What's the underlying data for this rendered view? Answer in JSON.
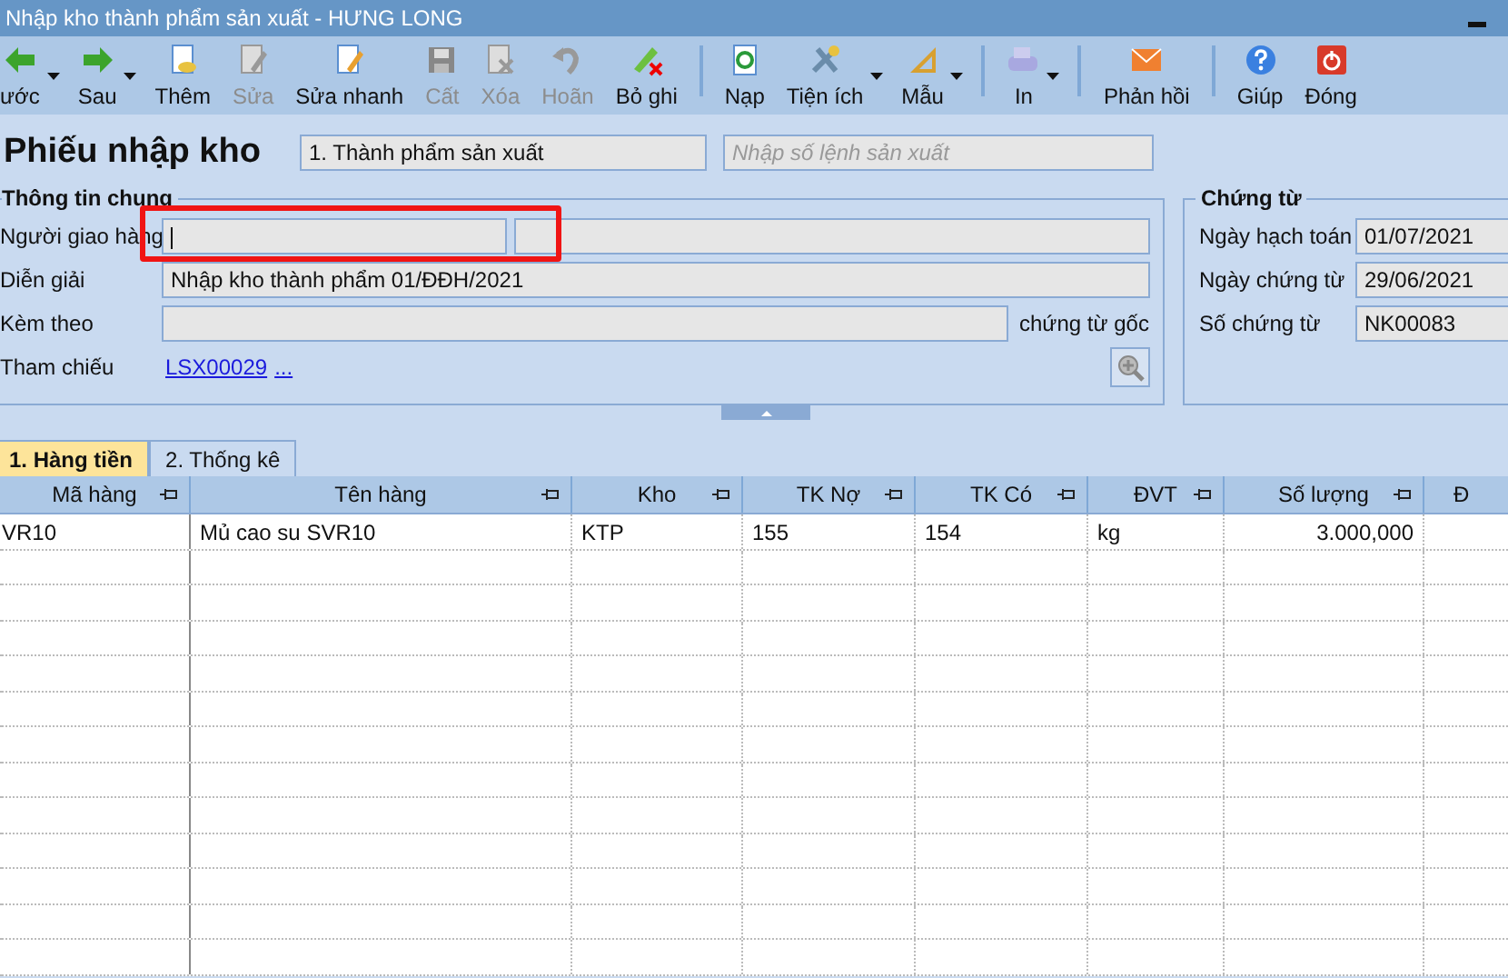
{
  "window": {
    "title": "Nhập kho thành phẩm sản xuất - HƯNG LONG"
  },
  "toolbar": [
    {
      "label": "ước",
      "disabled": false,
      "dropdown": true
    },
    {
      "label": "Sau",
      "disabled": false,
      "dropdown": true
    },
    {
      "label": "Thêm",
      "disabled": false,
      "dropdown": false
    },
    {
      "label": "Sửa",
      "disabled": true,
      "dropdown": false
    },
    {
      "label": "Sửa nhanh",
      "disabled": false,
      "dropdown": false
    },
    {
      "label": "Cất",
      "disabled": true,
      "dropdown": false
    },
    {
      "label": "Xóa",
      "disabled": true,
      "dropdown": false
    },
    {
      "label": "Hoãn",
      "disabled": true,
      "dropdown": false
    },
    {
      "label": "Bỏ ghi",
      "disabled": false,
      "dropdown": false,
      "separator_after": true
    },
    {
      "label": "Nạp",
      "disabled": false,
      "dropdown": false
    },
    {
      "label": "Tiện ích",
      "disabled": false,
      "dropdown": true
    },
    {
      "label": "Mẫu",
      "disabled": false,
      "dropdown": true,
      "separator_after": true
    },
    {
      "label": "In",
      "disabled": false,
      "dropdown": true,
      "separator_after": true
    },
    {
      "label": "Phản hồi",
      "disabled": false,
      "dropdown": false,
      "separator_after": true
    },
    {
      "label": "Giúp",
      "disabled": false,
      "dropdown": false
    },
    {
      "label": "Đóng",
      "disabled": false,
      "dropdown": false
    }
  ],
  "form": {
    "title": "Phiếu nhập kho",
    "type_combo": "1. Thành phẩm sản xuất",
    "order_field": {
      "placeholder": "Nhập số lệnh sản xuất"
    }
  },
  "general": {
    "legend": "Thông tin chung",
    "rows": [
      {
        "kind": "double",
        "label": "Người giao hàng",
        "highlighted": true,
        "focused": true
      },
      {
        "kind": "text",
        "label": "Diễn giải",
        "value": "Nhập kho thành phẩm 01/ĐĐH/2021"
      },
      {
        "kind": "attach",
        "label": "Kèm theo",
        "suffix": "chứng từ gốc"
      },
      {
        "kind": "link",
        "label": "Tham chiếu",
        "link": "LSX00029",
        "more": "..."
      }
    ]
  },
  "voucher": {
    "legend": "Chứng từ",
    "rows": [
      {
        "label": "Ngày hạch toán",
        "value": "01/07/2021"
      },
      {
        "label": "Ngày chứng từ",
        "value": "29/06/2021"
      },
      {
        "label": "Số chứng từ",
        "value": "NK00083"
      }
    ]
  },
  "tabs": [
    {
      "label": "1. Hàng tiền",
      "selected": true
    },
    {
      "label": "2. Thống kê",
      "selected": false
    }
  ],
  "grid": {
    "columns": [
      {
        "label": "Mã hàng"
      },
      {
        "label": "Tên hàng"
      },
      {
        "label": "Kho"
      },
      {
        "label": "TK Nợ"
      },
      {
        "label": "TK Có"
      },
      {
        "label": "ĐVT"
      },
      {
        "label": "Số lượng"
      },
      {
        "label": "Đ"
      }
    ],
    "rows": [
      [
        "VR10",
        "Mủ cao su SVR10",
        "KTP",
        "155",
        "154",
        "kg",
        "3.000,000"
      ]
    ]
  }
}
